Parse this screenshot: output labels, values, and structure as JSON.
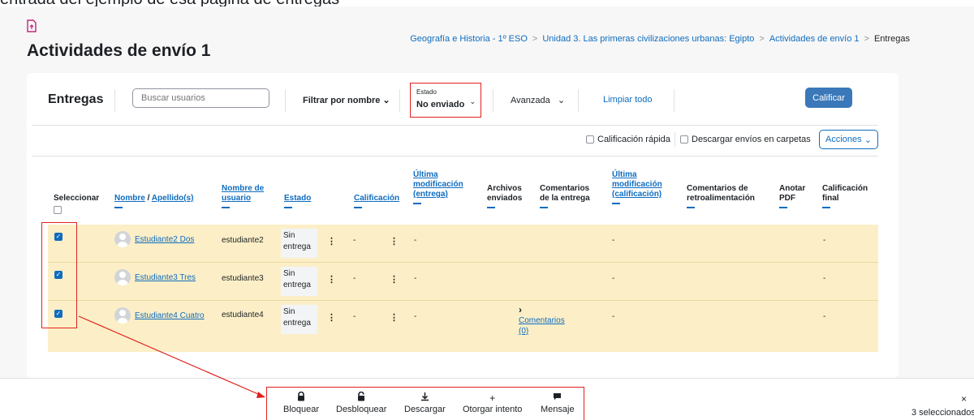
{
  "header": {
    "clipped_text": "entrada del ejemplo de esa página de entregas",
    "title": "Actividades de envío 1",
    "breadcrumb": [
      "Geografía e Historia - 1º ESO",
      "Unidad 3. Las primeras civilizaciones urbanas: Egipto",
      "Actividades de envío 1",
      "Entregas"
    ]
  },
  "toolbar": {
    "title": "Entregas",
    "search_placeholder": "Buscar usuarios",
    "filter_name": "Filtrar por nombre",
    "estado_label": "Estado",
    "estado_value": "No enviado",
    "avanzada": "Avanzada",
    "clear_all": "Limpiar todo",
    "grade_button": "Calificar"
  },
  "options": {
    "quick_grading": "Calificación rápida",
    "download_folders": "Descargar envíos en carpetas",
    "actions": "Acciones"
  },
  "table": {
    "headers": {
      "select": "Seleccionar",
      "first_name": "Nombre",
      "name_sep": "/",
      "last_name": "Apellido(s)",
      "username": [
        "Nombre de",
        "usuario"
      ],
      "status": "Estado",
      "grade": "Calificación",
      "last_mod_submission": [
        "Última",
        "modificación",
        "(entrega)"
      ],
      "files": [
        "Archivos",
        "enviados"
      ],
      "submission_comments": [
        "Comentarios",
        "de la entrega"
      ],
      "last_mod_grade": [
        "Última",
        "modificación",
        "(calificación)"
      ],
      "feedback_comments": [
        "Comentarios de",
        "retroalimentación"
      ],
      "annotate_pdf": [
        "Anotar",
        "PDF"
      ],
      "final_grade": [
        "Calificación",
        "final"
      ]
    },
    "rows": [
      {
        "name": "Estudiante2 Dos",
        "username": "estudiante2",
        "status": [
          "Sin",
          "entrega"
        ],
        "grade": "-",
        "last_mod": "-",
        "comments_link": "",
        "comments_count": "",
        "last_mod_grade": "-",
        "final_grade": "-"
      },
      {
        "name": "Estudiante3 Tres",
        "username": "estudiante3",
        "status": [
          "Sin",
          "entrega"
        ],
        "grade": "-",
        "last_mod": "-",
        "comments_link": "",
        "comments_count": "",
        "last_mod_grade": "-",
        "final_grade": "-"
      },
      {
        "name": "Estudiante4 Cuatro",
        "username": "estudiante4",
        "status": [
          "Sin",
          "entrega"
        ],
        "grade": "-",
        "last_mod": "-",
        "comments_link": "Comentarios",
        "comments_count": "(0)",
        "last_mod_grade": "-",
        "final_grade": "-"
      }
    ]
  },
  "bulk_actions": {
    "lock": "Bloquear",
    "unlock": "Desbloquear",
    "download": "Descargar",
    "grant_attempt": "Otorgar intento",
    "message": "Mensaje",
    "close": "×",
    "selected_count": "3 seleccionados"
  },
  "colors": {
    "accent": "#0f6cbf",
    "highlight_row": "#fcefc7",
    "annotation_red": "#e0201e",
    "grade_button": "#3a78b9"
  }
}
